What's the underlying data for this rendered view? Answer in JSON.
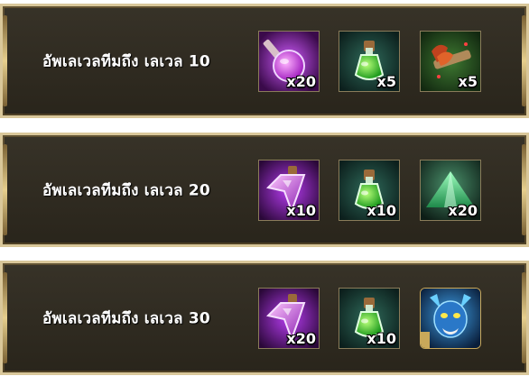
{
  "rewards": [
    {
      "label": "อัพเลเวลทีมถึง เลเวล 10",
      "items": [
        {
          "icon": "purple-potion-icon",
          "qty": "x20"
        },
        {
          "icon": "green-potion-icon",
          "qty": "x5"
        },
        {
          "icon": "hero-shard-icon",
          "qty": "x5"
        }
      ]
    },
    {
      "label": "อัพเลเวลทีมถึง เลเวล 20",
      "items": [
        {
          "icon": "purple-crystal-potion-icon",
          "qty": "x10"
        },
        {
          "icon": "green-potion-icon",
          "qty": "x10"
        },
        {
          "icon": "green-crystal-icon",
          "qty": "x20"
        }
      ]
    },
    {
      "label": "อัพเลเวลทีมถึง เลเวล 30",
      "items": [
        {
          "icon": "purple-crystal-potion-icon",
          "qty": "x20"
        },
        {
          "icon": "green-potion-icon",
          "qty": "x10"
        },
        {
          "icon": "blue-demon-hero-icon",
          "qty": ""
        }
      ]
    }
  ]
}
